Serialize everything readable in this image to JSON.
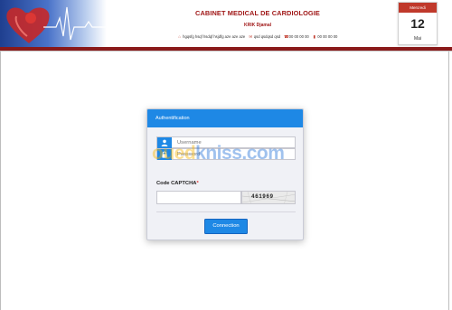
{
  "header": {
    "clinic_title": "CABINET MEDICAL DE CARDIOLOGIE",
    "doctor": "KRIK Djamal",
    "address": "hgqsfg hsqf hsdqf hsjdfg aze aze aze",
    "email": "qsd qsdqsd qsd",
    "phone": "00 00 00 00",
    "mobile": "00 00 00 00"
  },
  "calendar": {
    "day": "Mercredi",
    "date": "12",
    "month": "Mai"
  },
  "auth": {
    "title": "Authentification",
    "username_placeholder": "Username",
    "password_placeholder": "Password",
    "captcha_label": "Code CAPTCHA",
    "captcha_required": "*",
    "captcha_code": "461969",
    "submit_label": "Connection"
  },
  "watermark": {
    "part_a": "oued",
    "part_b": "kniss",
    "part_c": ".com"
  },
  "colors": {
    "accent": "#1e88e5",
    "brand_red": "#a01818",
    "header_rule": "#8a1a1a"
  }
}
